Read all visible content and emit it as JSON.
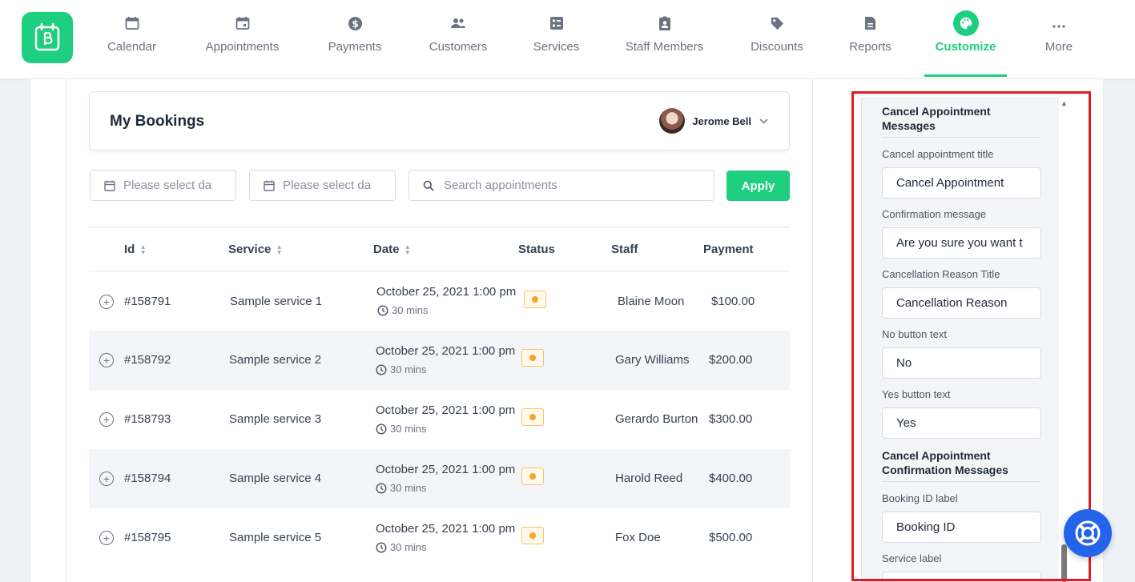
{
  "nav": {
    "items": [
      {
        "label": "Calendar",
        "icon": "calendar-icon"
      },
      {
        "label": "Appointments",
        "icon": "appointment-icon"
      },
      {
        "label": "Payments",
        "icon": "dollar-icon"
      },
      {
        "label": "Customers",
        "icon": "people-icon"
      },
      {
        "label": "Services",
        "icon": "services-icon"
      },
      {
        "label": "Staff Members",
        "icon": "staff-badge-icon"
      },
      {
        "label": "Discounts",
        "icon": "tag-icon"
      },
      {
        "label": "Reports",
        "icon": "report-icon"
      },
      {
        "label": "Customize",
        "icon": "palette-icon",
        "active": true
      },
      {
        "label": "More",
        "icon": "ellipsis-icon"
      }
    ],
    "accent_color": "#1fcf80"
  },
  "bookings": {
    "title": "My Bookings",
    "user_name": "Jerome Bell"
  },
  "filters": {
    "date_from_placeholder": "Please select date",
    "date_to_placeholder": "Please select date",
    "search_placeholder": "Search appointments",
    "apply_label": "Apply"
  },
  "table": {
    "columns": [
      "Id",
      "Service",
      "Date",
      "Status",
      "Staff",
      "Payment"
    ],
    "rows": [
      {
        "id": "#158791",
        "service": "Sample service 1",
        "date": "October 25, 2021 1:00 pm",
        "duration": "30 mins",
        "staff": "Blaine Moon",
        "payment": "$100.00"
      },
      {
        "id": "#158792",
        "service": "Sample service 2",
        "date": "October 25, 2021 1:00 pm",
        "duration": "30 mins",
        "staff": "Gary Williams",
        "payment": "$200.00"
      },
      {
        "id": "#158793",
        "service": "Sample service 3",
        "date": "October 25, 2021 1:00 pm",
        "duration": "30 mins",
        "staff": "Gerardo Burton",
        "payment": "$300.00"
      },
      {
        "id": "#158794",
        "service": "Sample service 4",
        "date": "October 25, 2021 1:00 pm",
        "duration": "30 mins",
        "staff": "Harold Reed",
        "payment": "$400.00"
      },
      {
        "id": "#158795",
        "service": "Sample service 5",
        "date": "October 25, 2021 1:00 pm",
        "duration": "30 mins",
        "staff": "Fox Doe",
        "payment": "$500.00"
      }
    ],
    "status_color": "#f5a623"
  },
  "settings": {
    "cancel_section_title": "Cancel Appointment Messages",
    "cancel_title_label": "Cancel appointment title",
    "cancel_title_value": "Cancel Appointment",
    "confirmation_label": "Confirmation message",
    "confirmation_value": "Are you sure you want t",
    "reason_title_label": "Cancellation Reason Title",
    "reason_title_value": "Cancellation Reason",
    "no_button_label": "No button text",
    "no_button_value": "No",
    "yes_button_label": "Yes button text",
    "yes_button_value": "Yes",
    "confirm_section_title": "Cancel Appointment Confirmation Messages",
    "booking_id_label": "Booking ID label",
    "booking_id_value": "Booking ID",
    "service_label": "Service label"
  },
  "highlight_color": "#e01b24",
  "help_button_color": "#2463eb"
}
